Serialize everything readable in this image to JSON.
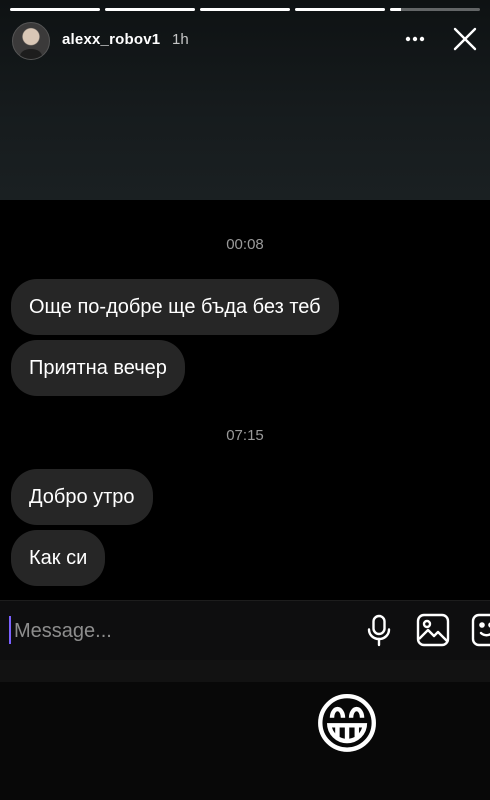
{
  "story": {
    "progress": [
      1,
      1,
      1,
      1,
      0.12
    ],
    "username": "alexx_robov1",
    "time_ago": "1h",
    "more_icon": "more-horizontal-icon",
    "close_icon": "close-icon"
  },
  "chat": {
    "blocks": [
      {
        "timestamp": "00:08",
        "messages": [
          "Още по-добре ще бъда без теб",
          "Приятна вечер"
        ]
      },
      {
        "timestamp": "07:15",
        "messages": [
          "Добро утро",
          "Как си"
        ]
      }
    ]
  },
  "composer": {
    "placeholder": "Message...",
    "icons": [
      "microphone-icon",
      "gallery-icon",
      "sticker-icon"
    ]
  },
  "sticker": {
    "emoji": "😁",
    "icon": "grinning-face-icon"
  },
  "colors": {
    "bubble": "#262626",
    "timestamp": "#9a9a9a",
    "cursor": "#7b61ff"
  }
}
